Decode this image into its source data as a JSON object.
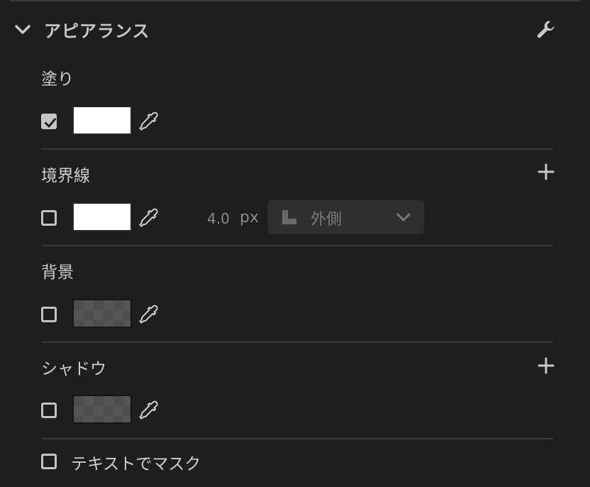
{
  "header": {
    "title": "アピアランス",
    "collapse_icon": "chevron-down-icon",
    "settings_icon": "wrench-icon"
  },
  "fill": {
    "label": "塗り",
    "enabled": true,
    "color": "#ffffff"
  },
  "stroke": {
    "label": "境界線",
    "enabled": false,
    "color": "#ffffff",
    "width": "4.0",
    "unit": "px",
    "alignment": "外側"
  },
  "background": {
    "label": "背景",
    "enabled": false,
    "color": "#4e4e4e"
  },
  "shadow": {
    "label": "シャドウ",
    "enabled": false,
    "color": "#4e4e4e"
  },
  "mask": {
    "label": "テキストでマスク",
    "enabled": false
  },
  "colors": {
    "panel_bg": "#1e1e1e",
    "text": "#cfcfcf",
    "divider": "#383838"
  }
}
